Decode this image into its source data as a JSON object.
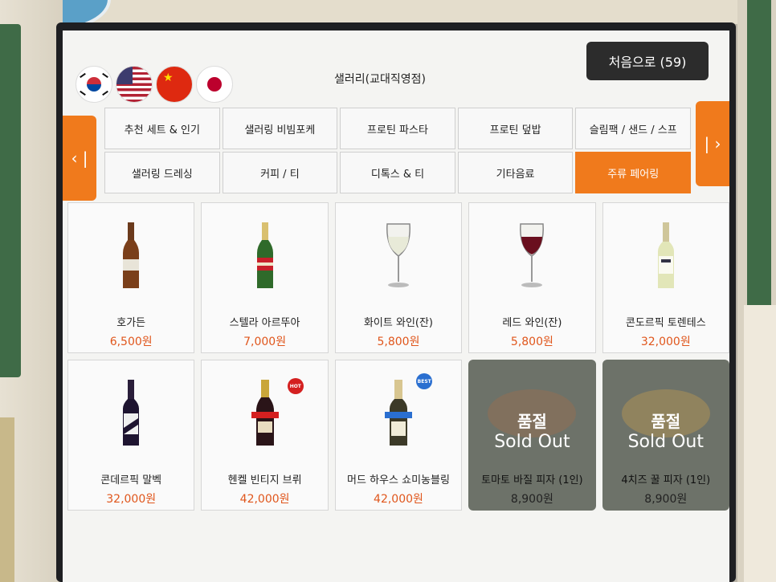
{
  "header": {
    "store_title": "샐러리(교대직영점)",
    "home_button": "처음으로 (59)"
  },
  "languages": [
    {
      "name": "korean-flag-icon"
    },
    {
      "name": "us-flag-icon"
    },
    {
      "name": "china-flag-icon"
    },
    {
      "name": "japan-flag-icon"
    }
  ],
  "nav": {
    "prev": "‹ |",
    "next": "| ›"
  },
  "tabs": [
    {
      "label": "추천 세트 & 인기"
    },
    {
      "label": "샐러링 비빔포케"
    },
    {
      "label": "프로틴 파스타"
    },
    {
      "label": "프로틴 덮밥"
    },
    {
      "label": "슬림팩 / 샌드 / 스프"
    },
    {
      "label": "샐러링 드레싱"
    },
    {
      "label": "커피 / 티"
    },
    {
      "label": "디톡스 & 티"
    },
    {
      "label": "기타음료"
    },
    {
      "label": "주류 페어링",
      "active": true
    }
  ],
  "products": [
    {
      "name": "호가든",
      "price": "6,500원",
      "icon": "beer-bottle-icon"
    },
    {
      "name": "스텔라 아르뚜아",
      "price": "7,000원",
      "icon": "beer-bottle-icon"
    },
    {
      "name": "화이트 와인(잔)",
      "price": "5,800원",
      "icon": "white-wine-glass-icon"
    },
    {
      "name": "레드 와인(잔)",
      "price": "5,800원",
      "icon": "red-wine-glass-icon"
    },
    {
      "name": "콘도르픽 토렌테스",
      "price": "32,000원",
      "icon": "wine-bottle-icon"
    },
    {
      "name": "콘데르픽 말벡",
      "price": "32,000원",
      "icon": "wine-bottle-icon"
    },
    {
      "name": "헨켈 빈티지 브뤼",
      "price": "42,000원",
      "icon": "sparkling-bottle-icon",
      "badge": "HOT"
    },
    {
      "name": "머드 하우스 쇼미농블링",
      "price": "42,000원",
      "icon": "wine-bottle-icon",
      "badge": "BEST"
    },
    {
      "name": "토마토 바질 피자 (1인)",
      "price": "8,900원",
      "icon": "pizza-icon",
      "soldout": true
    },
    {
      "name": "4치즈 꿀 피자 (1인)",
      "price": "8,900원",
      "icon": "pizza-icon",
      "soldout": true
    }
  ],
  "soldout_labels": {
    "ko": "품절",
    "en": "Sold Out"
  },
  "colors": {
    "accent": "#f07a1c",
    "price": "#e0561c",
    "home": "#2c2c2c"
  }
}
